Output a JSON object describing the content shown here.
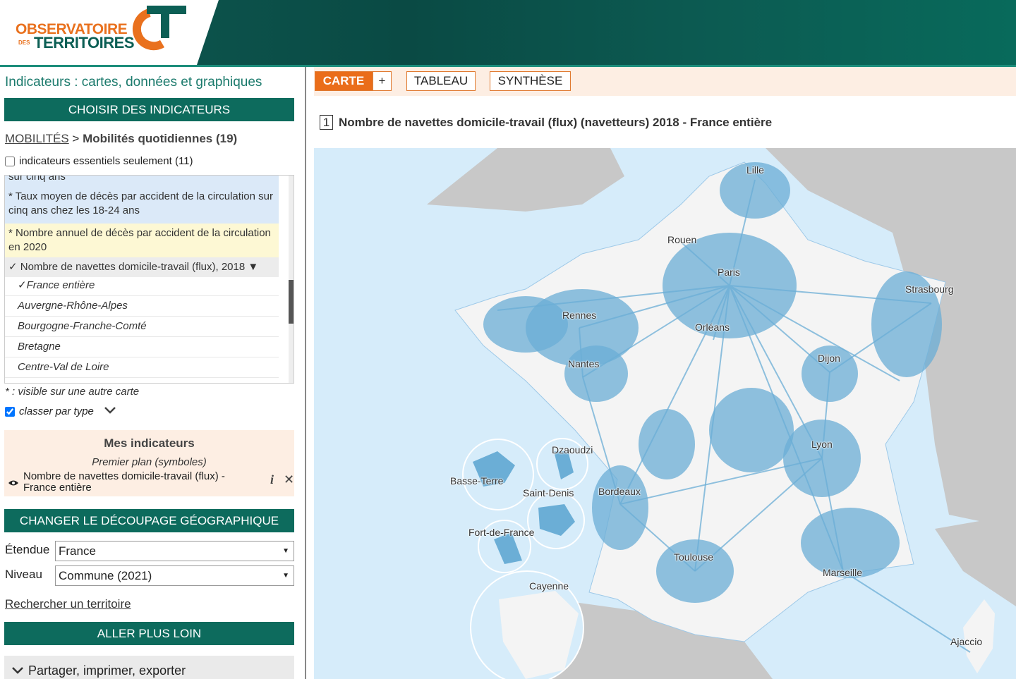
{
  "header": {
    "logo_line1": "OBSERVATOIRE",
    "logo_line2": "DES",
    "logo_line3": "TERRITOIRES"
  },
  "left": {
    "title": "Indicateurs : cartes, données et graphiques",
    "choose_button": "CHOISIR DES INDICATEURS",
    "breadcrumb_link": "MOBILITÉS",
    "breadcrumb_sep": " > ",
    "breadcrumb_current": "Mobilités quotidiennes (19)",
    "essential_checkbox": "indicateurs essentiels seulement (11)",
    "list": {
      "item_partial": "sur cinq ans",
      "item1": "* Taux moyen de décès par accident de la circulation sur cinq ans chez les 18-24 ans",
      "item2": "* Nombre annuel de décès par accident de la circulation en 2020",
      "item3": "✓ Nombre de navettes domicile-travail (flux), 2018 ▼",
      "sub": [
        "✓France entière",
        "Auvergne-Rhône-Alpes",
        "Bourgogne-Franche-Comté",
        "Bretagne",
        "Centre-Val de Loire"
      ]
    },
    "note": "* : visible sur une autre carte",
    "classer_checkbox": "classer par type",
    "my_indicators": {
      "heading": "Mes indicateurs",
      "subheading": "Premier plan (symboles)",
      "item": "Nombre de navettes domicile-travail (flux) - France entière"
    },
    "geo_button": "CHANGER LE DÉCOUPAGE GÉOGRAPHIQUE",
    "etendue_label": "Étendue",
    "etendue_value": "France",
    "niveau_label": "Niveau",
    "niveau_value": "Commune (2021)",
    "search_link": "Rechercher un territoire",
    "further_button": "ALLER PLUS LOIN",
    "share": "Partager, imprimer, exporter"
  },
  "tabs": {
    "carte": "CARTE",
    "plus": "+",
    "tableau": "TABLEAU",
    "synthese": "SYNTHÈSE"
  },
  "map": {
    "number": "1",
    "title": "Nombre de navettes domicile-travail (flux) (navetteurs) 2018 - France entière",
    "cities": {
      "lille": "Lille",
      "rouen": "Rouen",
      "paris": "Paris",
      "strasbourg": "Strasbourg",
      "rennes": "Rennes",
      "orleans": "Orléans",
      "nantes": "Nantes",
      "dijon": "Dijon",
      "lyon": "Lyon",
      "bordeaux": "Bordeaux",
      "toulouse": "Toulouse",
      "marseille": "Marseille",
      "ajaccio": "Ajaccio",
      "dzaoudzi": "Dzaoudzi",
      "basse_terre": "Basse-Terre",
      "saint_denis": "Saint-Denis",
      "fort_de_france": "Fort-de-France",
      "cayenne": "Cayenne"
    },
    "colors": {
      "flow": "#6baed6",
      "land": "#f4f4f4",
      "sea": "#d6ecfa",
      "neighbor": "#c8c8c8"
    }
  }
}
